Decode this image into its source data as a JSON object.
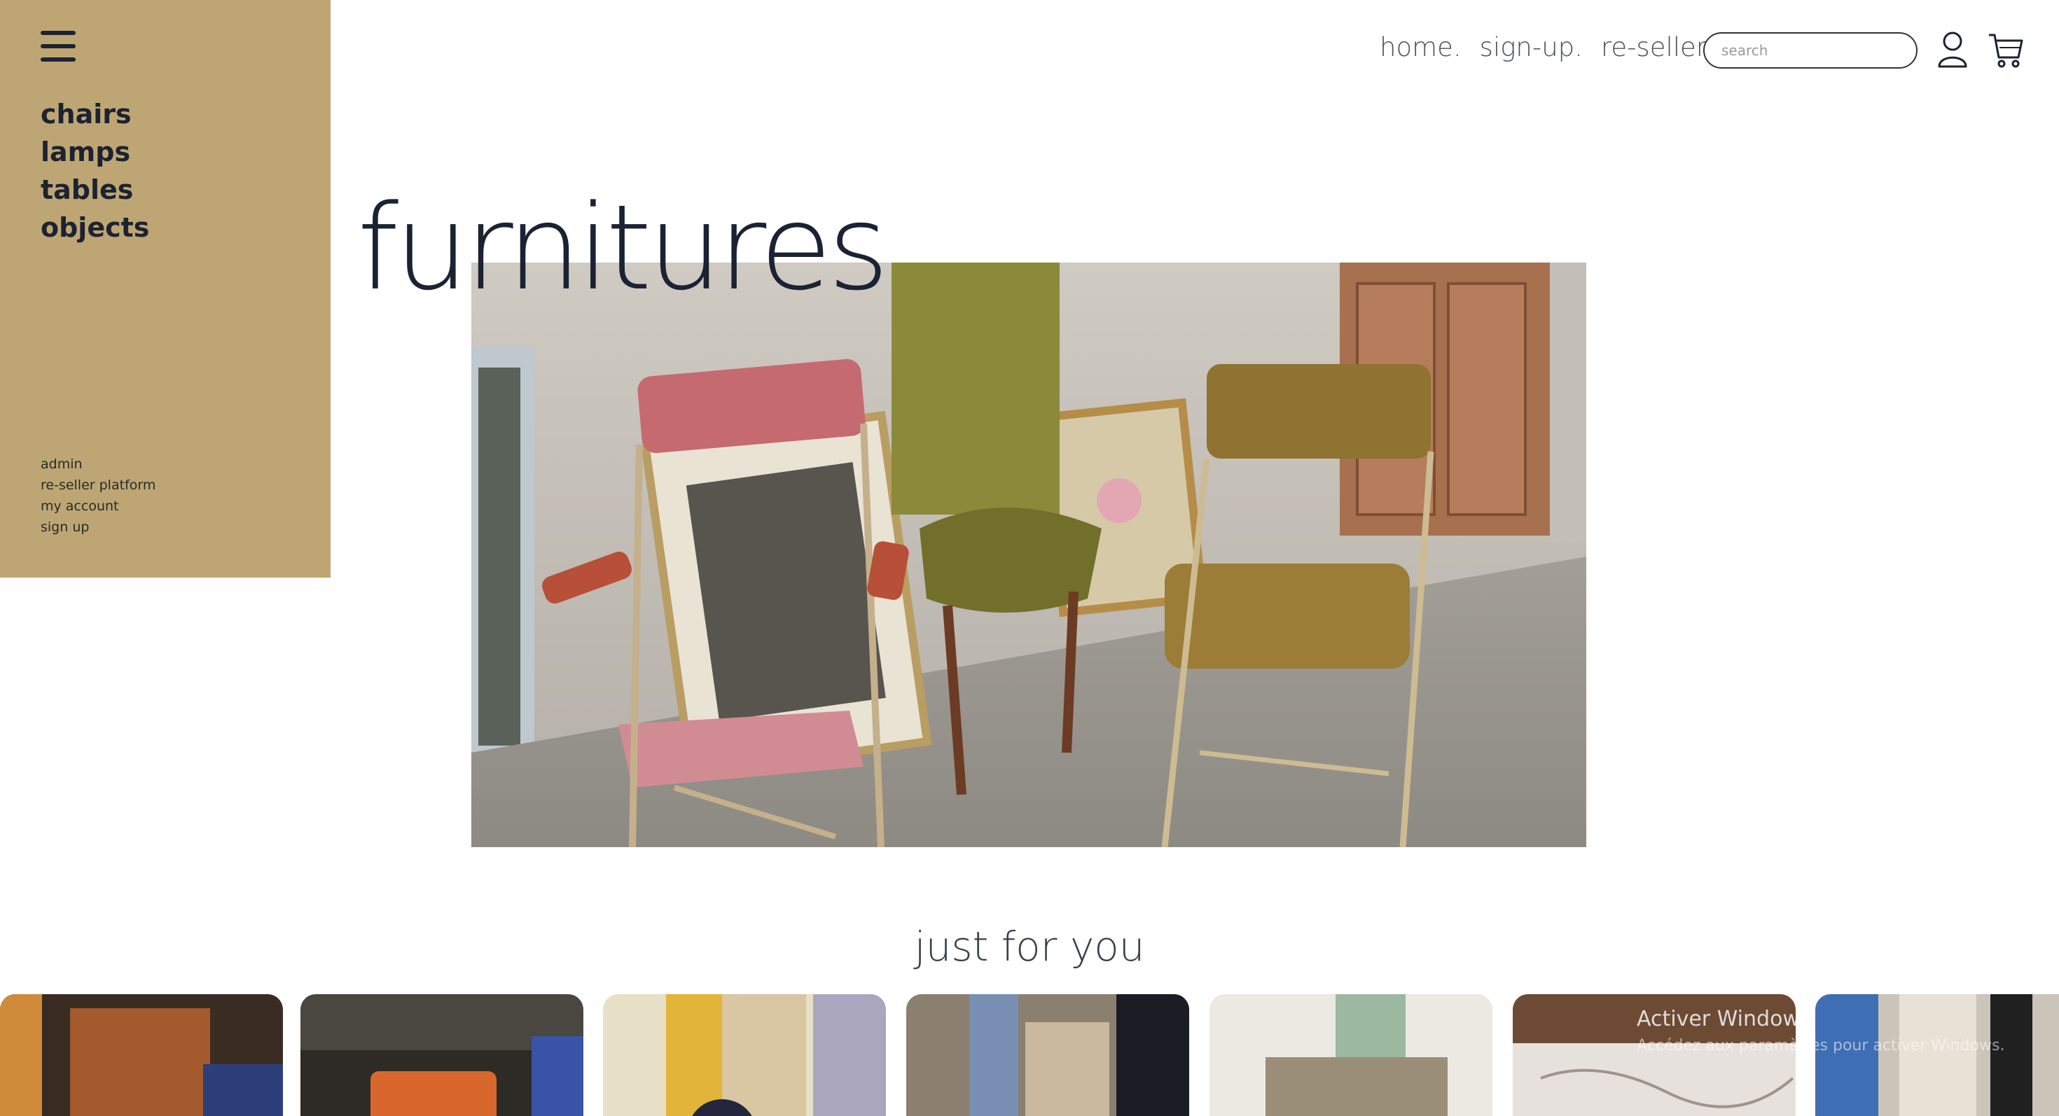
{
  "sidebar": {
    "categories": [
      "chairs",
      "lamps",
      "tables",
      "objects"
    ],
    "links": [
      "admin",
      "re-seller platform",
      "my account",
      "sign up"
    ]
  },
  "nav": {
    "home": "home.",
    "signup": "sign-up.",
    "reseller": "re-seller.",
    "search_placeholder": "search"
  },
  "hero": {
    "title": "furnitures"
  },
  "section": {
    "title": "just for you"
  },
  "watermark": {
    "line1": "Activer Windows",
    "line2": "Accédez aux paramètres pour activer Windows."
  },
  "colors": {
    "sidebar_bg": "#bda674",
    "text_dark": "#1d2230"
  },
  "icons": [
    "menu-icon",
    "user-icon",
    "cart-icon"
  ]
}
